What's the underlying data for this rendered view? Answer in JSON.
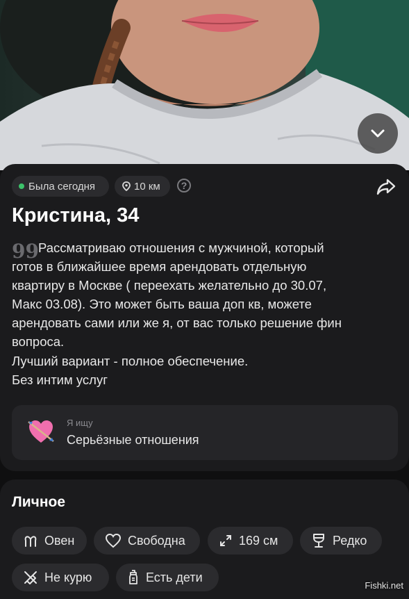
{
  "photo": {
    "expand_icon": "chevron-down-icon"
  },
  "status": {
    "online": "Была сегодня",
    "online_color": "#3cc26a",
    "distance": "10 км",
    "help": "?"
  },
  "profile": {
    "name_age": "Кристина, 34",
    "bio_quote": "99",
    "bio": "Рассматриваю отношения с мужчиной, который\nготов в ближайшее время арендовать отдельную\nквартиру в Москве ( переехать желательно до 30.07,\nМакс 03.08). Это может быть ваша доп кв, можете\nарендовать сами или же я, от вас только решение фин\nвопроса.\nЛучший вариант - полное обеспечение.\nБез интим услуг"
  },
  "seeking": {
    "label": "Я ищу",
    "value": "Серьёзные отношения",
    "icon": "heart-arrow-icon"
  },
  "personal": {
    "title": "Личное",
    "tags": [
      {
        "label": "Овен",
        "icon": "aries-icon"
      },
      {
        "label": "Свободна",
        "icon": "heart-outline-icon"
      },
      {
        "label": "169 см",
        "icon": "height-arrows-icon"
      },
      {
        "label": "Редко",
        "icon": "wine-glass-icon"
      },
      {
        "label": "Не курю",
        "icon": "no-smoking-icon"
      },
      {
        "label": "Есть дети",
        "icon": "baby-bottle-icon"
      }
    ]
  },
  "watermark": "Fishki.net"
}
